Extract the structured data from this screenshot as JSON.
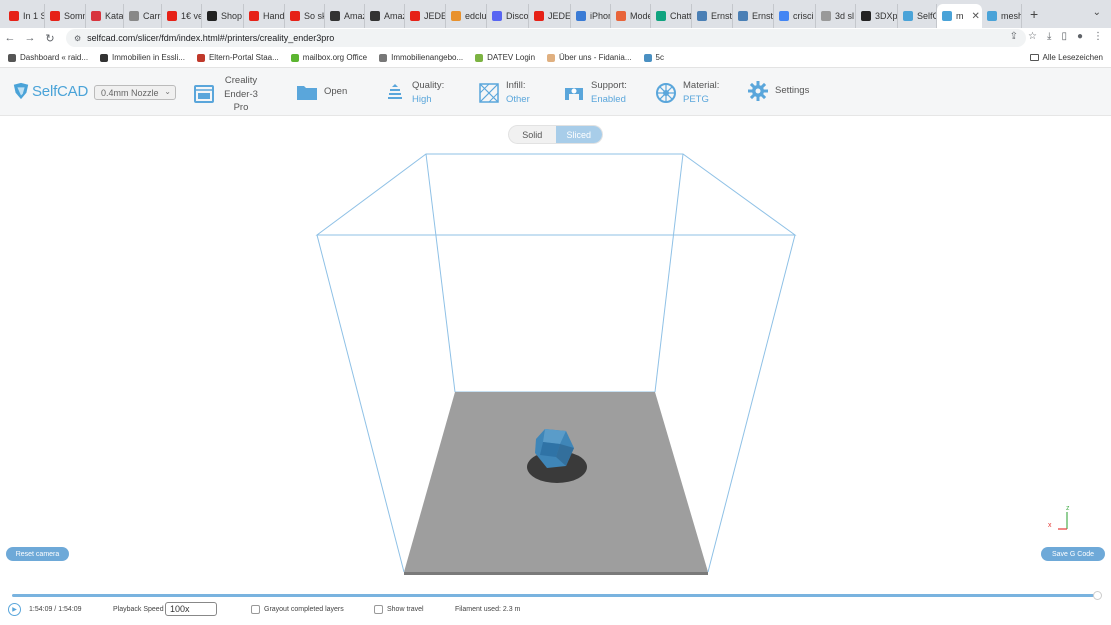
{
  "browser": {
    "tabs": [
      {
        "title": "In 1 S",
        "color": "#e62117"
      },
      {
        "title": "Somm",
        "color": "#e62117"
      },
      {
        "title": "Katal",
        "color": "#d8343d"
      },
      {
        "title": "Carre",
        "color": "#888888"
      },
      {
        "title": "1€ ve",
        "color": "#e62117"
      },
      {
        "title": "Shop",
        "color": "#222222"
      },
      {
        "title": "Hand",
        "color": "#e62117"
      },
      {
        "title": "So sk",
        "color": "#e62117"
      },
      {
        "title": "Amaz",
        "color": "#333333"
      },
      {
        "title": "Amaz",
        "color": "#333333"
      },
      {
        "title": "JEDE",
        "color": "#e62117"
      },
      {
        "title": "edclu",
        "color": "#e8912d"
      },
      {
        "title": "Disco",
        "color": "#5865f2"
      },
      {
        "title": "JEDE",
        "color": "#e62117"
      },
      {
        "title": "iPhon",
        "color": "#3a7bd5"
      },
      {
        "title": "Mode",
        "color": "#e8643a"
      },
      {
        "title": "Chatt",
        "color": "#10a37f"
      },
      {
        "title": "Ernst",
        "color": "#4a7fb5"
      },
      {
        "title": "Ernst",
        "color": "#4a7fb5"
      },
      {
        "title": "crisci",
        "color": "#4285f4"
      },
      {
        "title": "3d sl",
        "color": "#999999"
      },
      {
        "title": "3DXp",
        "color": "#222222"
      },
      {
        "title": "SelfC",
        "color": "#4aa3d8"
      },
      {
        "title": "m",
        "color": "#4aa3d8",
        "active": true
      },
      {
        "title": "mesh",
        "color": "#4aa3d8"
      }
    ],
    "close_glyph": "✕",
    "new_tab_glyph": "+",
    "tab_menu_glyph": "⌄",
    "url": "selfcad.com/slicer/fdm/index.html#/printers/creality_ender3pro",
    "bookmarks": [
      {
        "label": "Dashboard « raid...",
        "color": "#555555"
      },
      {
        "label": "Immobilien in Essli...",
        "color": "#333333"
      },
      {
        "label": "Eltern-Portal Staa...",
        "color": "#c0392b"
      },
      {
        "label": "mailbox.org Office",
        "color": "#5cb531"
      },
      {
        "label": "Immobilienangebo...",
        "color": "#777777"
      },
      {
        "label": "DATEV Login",
        "color": "#7cb342"
      },
      {
        "label": "Über uns - Fidania...",
        "color": "#e0b080"
      },
      {
        "label": "5c",
        "color": "#4a90c2"
      }
    ],
    "all_bookmarks": "Alle Lesezeichen"
  },
  "toolbar": {
    "logo": "SelfCAD",
    "nozzle": "0.4mm Nozzle",
    "printer_lines": [
      "Creality",
      "Ender-3",
      "Pro"
    ],
    "open": "Open",
    "quality_label": "Quality:",
    "quality_value": "High",
    "infill_label": "Infill:",
    "infill_value": "Other",
    "support_label": "Support:",
    "support_value": "Enabled",
    "material_label": "Material:",
    "material_value": "PETG",
    "settings": "Settings"
  },
  "viewport": {
    "mode_solid": "Solid",
    "mode_sliced": "Sliced",
    "active_mode": "Sliced",
    "reset_camera": "Reset camera",
    "save_gcode": "Save G Code",
    "axis_x": "x",
    "axis_z": "z",
    "colors": {
      "frame": "#8fc1e6",
      "bed_top": "#9e9e9e",
      "bed_edge": "#7a7a7a",
      "model": "#3f86b8",
      "shadow": "#3a3a3a"
    }
  },
  "playback": {
    "time": "1:54:09 / 1:54:09",
    "progress": 1.0,
    "speed_label": "Playback Speed",
    "speed_value": "100x",
    "grayout_label": "Grayout completed layers",
    "show_travel_label": "Show travel",
    "filament": "Filament used: 2.3 m"
  }
}
